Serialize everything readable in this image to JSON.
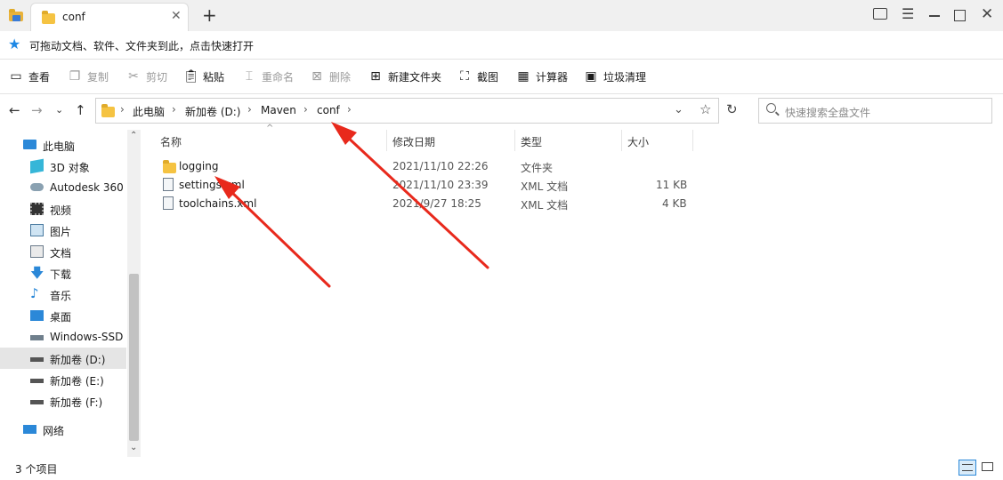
{
  "tab": {
    "title": "conf"
  },
  "hint": {
    "text": "可拖动文档、软件、文件夹到此，点击快速打开"
  },
  "toolbar": {
    "view": "查看",
    "copy": "复制",
    "cut": "剪切",
    "paste": "粘贴",
    "rename": "重命名",
    "delete": "删除",
    "new_folder": "新建文件夹",
    "screenshot": "截图",
    "calculator": "计算器",
    "cleanup": "垃圾清理"
  },
  "breadcrumb": [
    "此电脑",
    "新加卷 (D:)",
    "Maven",
    "conf"
  ],
  "search": {
    "placeholder": "快速搜索全盘文件"
  },
  "sidebar": {
    "items": [
      {
        "label": "此电脑"
      },
      {
        "label": "3D 对象"
      },
      {
        "label": "Autodesk 360"
      },
      {
        "label": "视频"
      },
      {
        "label": "图片"
      },
      {
        "label": "文档"
      },
      {
        "label": "下载"
      },
      {
        "label": "音乐"
      },
      {
        "label": "桌面"
      },
      {
        "label": "Windows-SSD"
      },
      {
        "label": "新加卷 (D:)"
      },
      {
        "label": "新加卷 (E:)"
      },
      {
        "label": "新加卷 (F:)"
      },
      {
        "label": "网络"
      }
    ]
  },
  "columns": {
    "name": "名称",
    "modified": "修改日期",
    "type": "类型",
    "size": "大小"
  },
  "files": [
    {
      "name": "logging",
      "modified": "2021/11/10 22:26",
      "type": "文件夹",
      "size": ""
    },
    {
      "name": "settings.xml",
      "modified": "2021/11/10 23:39",
      "type": "XML 文档",
      "size": "11 KB"
    },
    {
      "name": "toolchains.xml",
      "modified": "2021/9/27 18:25",
      "type": "XML 文档",
      "size": "4 KB"
    }
  ],
  "status": {
    "count": "3 个项目"
  },
  "colors": {
    "selected": "#e5e5e5",
    "annotation": "#e8291c",
    "star": "#1e88e5"
  }
}
